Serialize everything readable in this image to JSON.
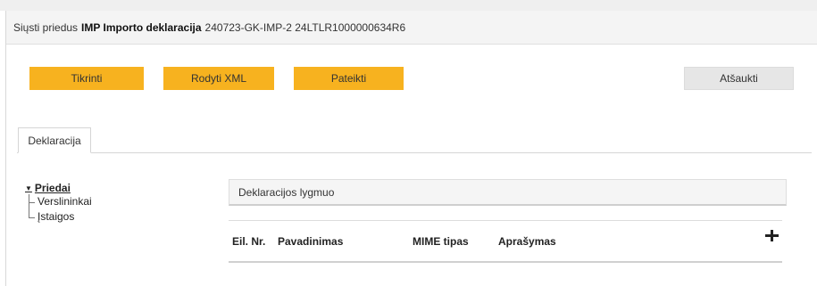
{
  "header": {
    "prefix": "Siųsti priedus",
    "doc_type": "IMP Importo deklaracija",
    "doc_id": "240723-GK-IMP-2 24LTLR1000000634R6"
  },
  "toolbar": {
    "check_label": "Tikrinti",
    "show_xml_label": "Rodyti XML",
    "submit_label": "Pateikti",
    "cancel_label": "Atšaukti"
  },
  "tabs": [
    {
      "label": "Deklaracija",
      "active": true
    }
  ],
  "tree": {
    "root_label": "Priedai",
    "children": [
      "Verslininkai",
      "Įstaigos"
    ]
  },
  "level": {
    "label": "Deklaracijos lygmuo"
  },
  "table": {
    "columns": [
      "Eil. Nr.",
      "Pavadinimas",
      "MIME tipas",
      "Aprašymas"
    ]
  },
  "colors": {
    "accent": "#f7b21f",
    "secondary_button": "#e6e6e6"
  }
}
